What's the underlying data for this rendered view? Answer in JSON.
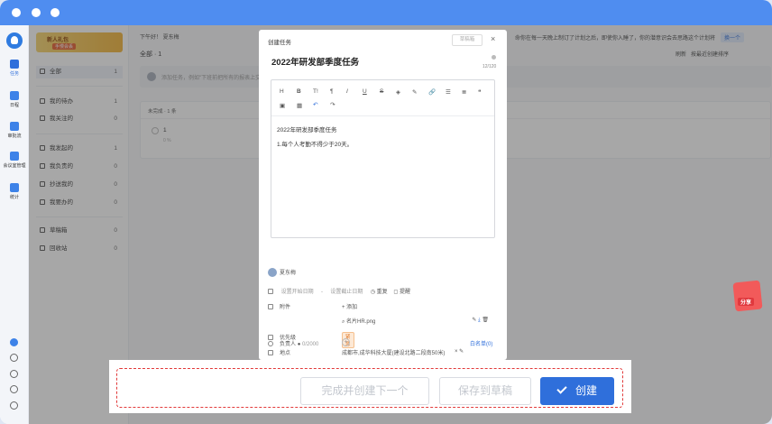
{
  "window": {
    "title_bar_color": "#4f8df0"
  },
  "rail": {
    "items": [
      {
        "label": "任务",
        "icon": "task-icon"
      },
      {
        "label": "日程",
        "icon": "calendar-icon"
      },
      {
        "label": "审批流",
        "icon": "approval-icon"
      },
      {
        "label": "会议室管理",
        "icon": "meeting-room-icon"
      },
      {
        "label": "统计",
        "icon": "stats-icon"
      }
    ]
  },
  "sidebar": {
    "banner_title": "新人礼包",
    "banner_sub": "手慢会丢",
    "all": {
      "label": "全部",
      "count": "1"
    },
    "group1": [
      {
        "label": "我的待办",
        "count": "1"
      },
      {
        "label": "我关注的",
        "count": "0"
      }
    ],
    "group2": [
      {
        "label": "我发起的",
        "count": "1"
      },
      {
        "label": "我负责的",
        "count": "0"
      },
      {
        "label": "抄送我的",
        "count": "0"
      },
      {
        "label": "我要办的",
        "count": "0"
      }
    ],
    "group3": [
      {
        "label": "草稿箱",
        "count": "0"
      },
      {
        "label": "回收站",
        "count": "0"
      }
    ]
  },
  "main": {
    "greeting": "下午好！ 夏东梅",
    "notice": "命你在每一天晚上制订了计划之后，即使你入睡了，你的潜意识会去思路这个计划将",
    "notice_tag": "换一个",
    "filter_title": "全部 · 1",
    "refresh": "刷新",
    "sort": "按最近创建排序",
    "quick_add_placeholder": "添加任务，例如\"下班前把所有的报表上交\"",
    "group_header": "未完成 · 1 条",
    "task_title": "1",
    "task_sub": "0 %"
  },
  "dialog": {
    "title": "创建任务",
    "draft_box": "草稿箱",
    "task_name": "2022年研发部季度任务",
    "char_count": "12/120",
    "toolbar": [
      "H",
      "B",
      "T!",
      "¶",
      "I",
      "U",
      "S",
      "◈",
      "✎",
      "🔗",
      "☰",
      "≣",
      "❝",
      "▣",
      "▦",
      "↶",
      "↷"
    ],
    "body_lines": [
      "2022年研发部季度任务",
      "1.每个人考勤不得少于20天。"
    ],
    "creator": "夏东梅",
    "start_date": "设置开始日期",
    "dash": "-",
    "end_date": "设置截止日期",
    "repeat": "重复",
    "remind": "提醒",
    "attachment_label": "附件",
    "attachment_add": "+ 添加",
    "attachment_file": "名片HR.png",
    "priority_label": "优先级",
    "priority_value": "紧急",
    "location_label": "地点",
    "location_value": "成都市,成华科技大厦(建设北路二段南50米)",
    "owner_label": "负责人",
    "owner_count": "0/2000",
    "whitelist": "白名单(0)"
  },
  "share": {
    "label": "分享"
  },
  "footer": {
    "create_next": "完成并创建下一个",
    "save_draft": "保存到草稿",
    "create": "创建"
  }
}
